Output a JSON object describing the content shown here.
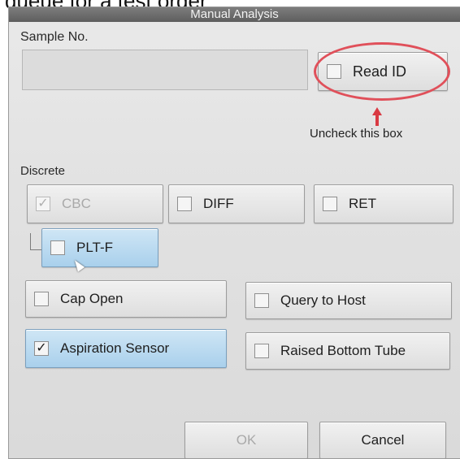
{
  "caption": "queue for a test order",
  "window": {
    "title": "Manual Analysis"
  },
  "sample": {
    "label": "Sample No.",
    "value": ""
  },
  "read_id": {
    "label": "Read ID",
    "checked": false
  },
  "annotation": {
    "text": "Uncheck this box",
    "color": "#e0505a"
  },
  "discrete": {
    "label": "Discrete",
    "cbc": {
      "label": "CBC",
      "checked": true,
      "disabled": true
    },
    "diff": {
      "label": "DIFF",
      "checked": false
    },
    "ret": {
      "label": "RET",
      "checked": false
    },
    "pltf": {
      "label": "PLT-F",
      "checked": false
    }
  },
  "options": {
    "cap_open": {
      "label": "Cap Open",
      "checked": false
    },
    "query_to_host": {
      "label": "Query to Host",
      "checked": false
    },
    "aspiration_sensor": {
      "label": "Aspiration Sensor",
      "checked": true
    },
    "raised_bottom_tube": {
      "label": "Raised Bottom Tube",
      "checked": false
    }
  },
  "buttons": {
    "ok": "OK",
    "cancel": "Cancel"
  },
  "check_glyph": "✓",
  "colors": {
    "active_button": "#a9d0ec",
    "titlebar": "#6a6a6a"
  }
}
